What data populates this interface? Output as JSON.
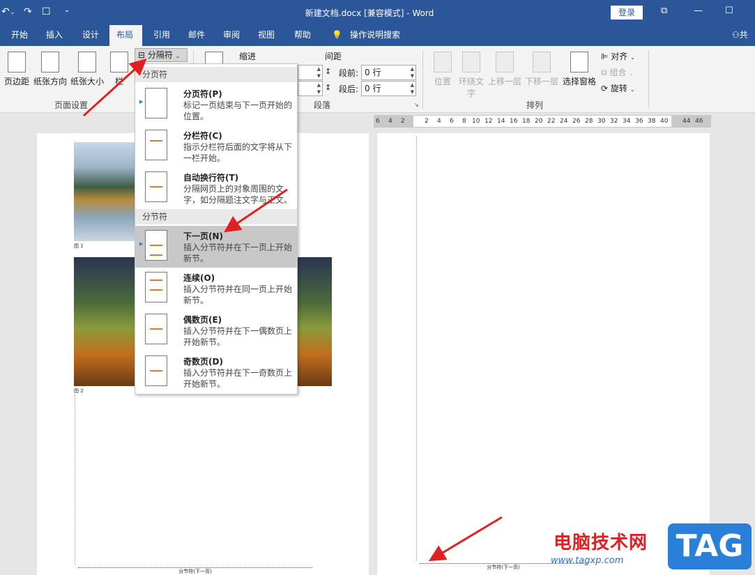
{
  "titlebar": {
    "title": "新建文档.docx [兼容模式] - Word",
    "login": "登录",
    "undo_icon": "undo-icon",
    "redo_icon": "redo-icon"
  },
  "tabs": [
    "开始",
    "插入",
    "设计",
    "布局",
    "引用",
    "邮件",
    "审阅",
    "视图",
    "帮助",
    "操作说明搜索"
  ],
  "active_tab": "布局",
  "share_label": "共享",
  "ribbon": {
    "page_setup": {
      "margins": "页边距",
      "orientation": "纸张方向",
      "size": "纸张大小",
      "columns": "栏",
      "breaks": "分隔符",
      "group_label": "页面设置"
    },
    "paragraph": {
      "indent_label": "缩进",
      "spacing_label": "间距",
      "before_label": "段前:",
      "before_value": "0 行",
      "after_label": "段后:",
      "after_value": "0 行",
      "group_label": "段落"
    },
    "arrange": {
      "position": "位置",
      "wrap_text_1": "环绕文",
      "wrap_text_2": "字",
      "bring_forward": "上移一层",
      "send_backward": "下移一层",
      "selection_pane": "选择窗格",
      "align": "对齐",
      "group": "组合",
      "rotate": "旋转",
      "group_label": "排列"
    }
  },
  "dropdown": {
    "page_breaks_header": "分页符",
    "section_breaks_header": "分节符",
    "items": [
      {
        "title": "分页符(P)",
        "desc": "标记一页结束与下一页开始的位置。"
      },
      {
        "title": "分栏符(C)",
        "desc": "指示分栏符后面的文字将从下一栏开始。"
      },
      {
        "title": "自动换行符(T)",
        "desc": "分隔网页上的对象周围的文字，如分隔题注文字与正文。"
      },
      {
        "title": "下一页(N)",
        "desc": "插入分节符并在下一页上开始新节。"
      },
      {
        "title": "连续(O)",
        "desc": "插入分节符并在同一页上开始新节。"
      },
      {
        "title": "偶数页(E)",
        "desc": "插入分节符并在下一偶数页上开始新节。"
      },
      {
        "title": "奇数页(D)",
        "desc": "插入分节符并在下一奇数页上开始新节。"
      }
    ],
    "selected_index": 3
  },
  "document": {
    "caption1": "图 1",
    "caption2": "图 2",
    "section_break": "分节符(下一页)",
    "section_break_right": "分节符(下一页)"
  },
  "ruler_ticks": [
    "6",
    "4",
    "2",
    "2",
    "4",
    "6",
    "8",
    "10",
    "12",
    "14",
    "16",
    "18",
    "20",
    "22",
    "24",
    "26",
    "28",
    "30",
    "32",
    "34",
    "36",
    "38",
    "40",
    "44",
    "46"
  ],
  "watermark": {
    "text": "电脑技术网",
    "url": "www.tagxp.com",
    "badge": "TAG"
  },
  "colors": {
    "brand": "#2b579a",
    "arrow": "#e02020",
    "selection": "#c8c8c8"
  }
}
